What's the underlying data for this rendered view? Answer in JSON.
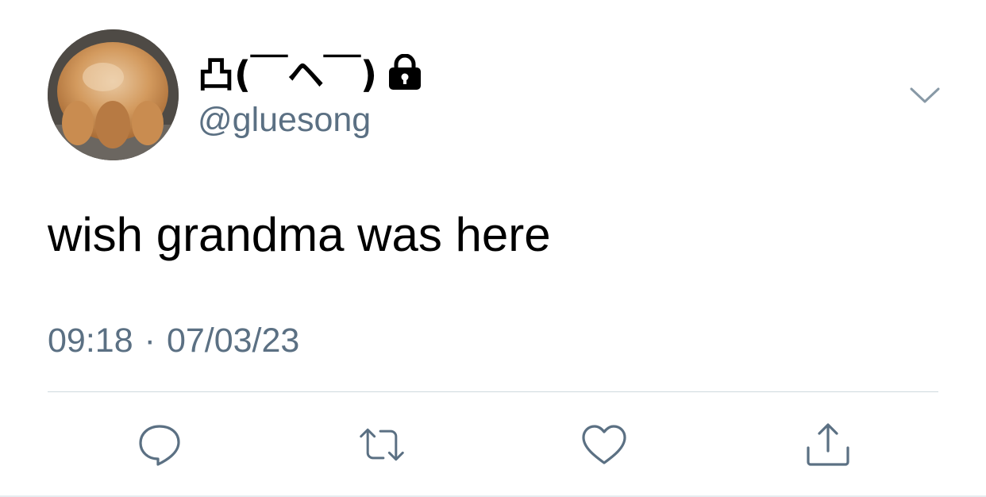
{
  "tweet": {
    "author": {
      "display_name": "凸(￣ヘ￣)",
      "handle": "@gluesong",
      "protected_icon": "lock-icon",
      "avatar": "kitten-avatar"
    },
    "menu_icon": "chevron-down-icon",
    "text": "wish grandma was here",
    "time": "09:18",
    "separator": "·",
    "date": "07/03/23",
    "actions": [
      {
        "name": "reply",
        "icon": "speech-bubble-icon"
      },
      {
        "name": "retweet",
        "icon": "retweet-arrows-icon"
      },
      {
        "name": "like",
        "icon": "heart-icon"
      },
      {
        "name": "share",
        "icon": "share-upload-icon"
      }
    ]
  },
  "colors": {
    "text": "#000000",
    "secondary": "#5b7083",
    "divider": "#cfd9de",
    "background": "#ffffff"
  }
}
